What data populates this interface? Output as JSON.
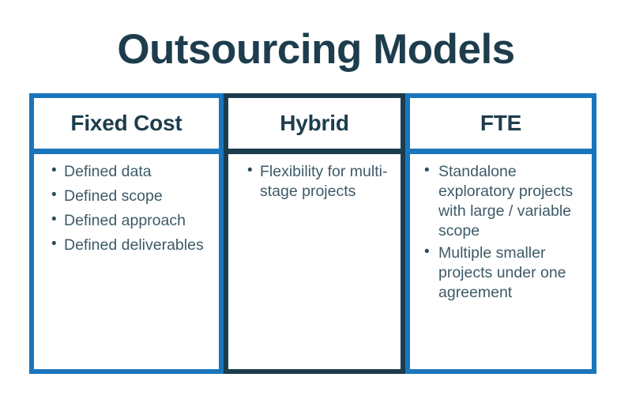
{
  "title": "Outsourcing Models",
  "theme": {
    "background": "#ffffff",
    "title_color": "#1d3d4d",
    "accent_blue": "#1a76bc",
    "accent_dark": "#1b3d4d",
    "body_text_color": "#3d5a68",
    "header_text_color": "#1d3d4d"
  },
  "columns": [
    {
      "header": "Fixed Cost",
      "frame_color": "#1a76bc",
      "items": [
        "Defined data",
        "Defined scope",
        "Defined approach",
        "Defined deliverables"
      ]
    },
    {
      "header": "Hybrid",
      "frame_color": "#1b3d4d",
      "items": [
        "Flexibility for multi-stage projects"
      ]
    },
    {
      "header": "FTE",
      "frame_color": "#1a76bc",
      "items": [
        "Standalone exploratory projects with large / variable scope",
        "Multiple smaller projects under one agreement"
      ]
    }
  ]
}
